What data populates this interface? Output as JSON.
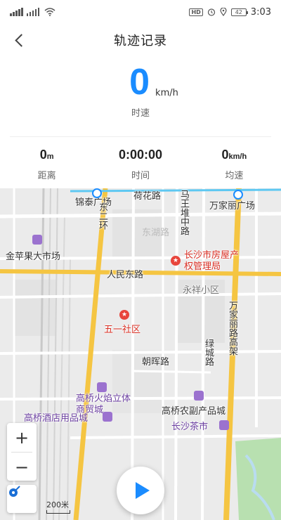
{
  "status_bar": {
    "hd_badge": "HD",
    "battery": "42",
    "time": "3:03"
  },
  "header": {
    "title": "轨迹记录"
  },
  "speed": {
    "value": "0",
    "unit": "km/h",
    "label": "时速"
  },
  "stats": [
    {
      "value": "0",
      "unit": "m",
      "label": "距离"
    },
    {
      "value": "0:00:00",
      "unit": "",
      "label": "时间"
    },
    {
      "value": "0",
      "unit": "km/h",
      "label": "均速"
    }
  ],
  "map": {
    "labels": {
      "hehua": "荷花路",
      "jintai": "锦泰广场",
      "dongerhuan": "东二环",
      "mawangdui": "马王堆中路",
      "wanjiali_plaza": "万家丽广场",
      "faint_road": "东湖路",
      "jinpingguo": "金苹果大市场",
      "changsha_house": "长沙市房屋产权管理局",
      "renmin": "人民东路",
      "yongxiang": "永祥小区",
      "wanjiali_road": "万家丽路高架",
      "wuyi": "五一社区",
      "lvcheng": "绿城路",
      "chaohui": "朝晖路",
      "gaoqiao_fire": "高桥火焰立体商贸城",
      "gaoqiao_hotel": "高桥酒店用品城",
      "gaoqiao_farm": "高桥农副产品城",
      "changsha_tea": "长沙茶市"
    },
    "scale": "200米",
    "colors": {
      "arterial": "#f5c542",
      "track": "#5ec8f2",
      "water": "#b9dcf0",
      "green": "#b8e0b0"
    }
  },
  "controls": {
    "zoom_in": "+",
    "zoom_out": "−"
  },
  "icons": {
    "back": "chevron-left-icon",
    "play": "play-icon",
    "locate": "locate-icon"
  }
}
